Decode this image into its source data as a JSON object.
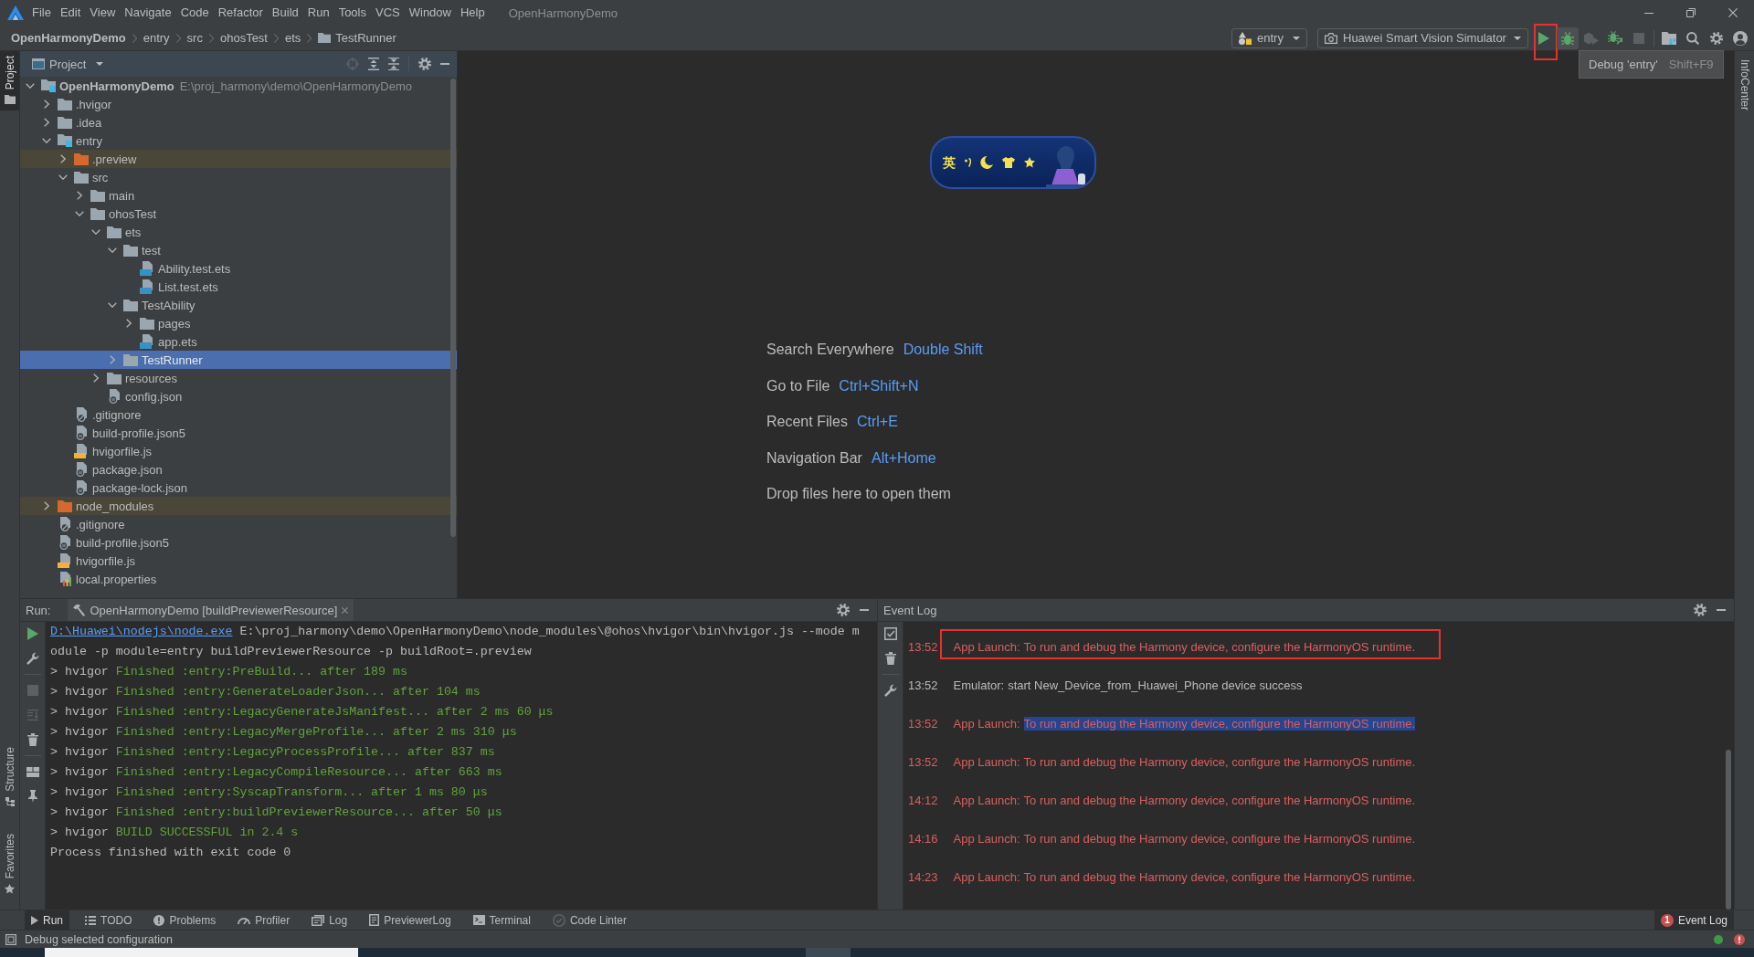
{
  "menu_bar": {
    "items": [
      "File",
      "Edit",
      "View",
      "Navigate",
      "Code",
      "Refactor",
      "Build",
      "Run",
      "Tools",
      "VCS",
      "Window",
      "Help"
    ],
    "project_title": "OpenHarmonyDemo"
  },
  "navigation_bar": {
    "breadcrumb": [
      {
        "label": "OpenHarmonyDemo",
        "kind": "project"
      },
      {
        "label": "entry",
        "kind": "directory"
      },
      {
        "label": "src",
        "kind": "directory"
      },
      {
        "label": "ohosTest",
        "kind": "directory"
      },
      {
        "label": "ets",
        "kind": "directory"
      },
      {
        "label": "TestRunner",
        "kind": "folder"
      }
    ],
    "run_configuration": "entry",
    "device": "Huawei Smart Vision Simulator",
    "run_toolbar": [
      {
        "kind": "run",
        "disabled": false,
        "hovered": false,
        "annotated": true
      },
      {
        "kind": "debug",
        "disabled": false,
        "hovered": true,
        "annotated": false
      },
      {
        "kind": "profile",
        "disabled": true,
        "hovered": false,
        "annotated": false
      },
      {
        "kind": "attach-debugger",
        "disabled": false,
        "hovered": false,
        "annotated": false
      },
      {
        "kind": "stop",
        "disabled": true,
        "hovered": false,
        "annotated": false
      }
    ],
    "app_tools": [
      {
        "kind": "project-structure",
        "disabled": false,
        "hovered": false,
        "annotated": false
      },
      {
        "kind": "search",
        "disabled": false,
        "hovered": false,
        "annotated": false
      },
      {
        "kind": "settings",
        "disabled": false,
        "hovered": false,
        "annotated": false
      },
      {
        "kind": "account",
        "disabled": false,
        "hovered": false,
        "annotated": false
      }
    ],
    "tooltip": {
      "text": "Debug 'entry'",
      "shortcut": "Shift+F9"
    }
  },
  "left_stripe": {
    "top": [
      {
        "label": "Project",
        "kind": "project",
        "selected": true
      }
    ],
    "bottom": [
      {
        "label": "Structure",
        "kind": "structure",
        "selected": false
      },
      {
        "label": "Favorites",
        "kind": "favorites",
        "selected": false
      }
    ]
  },
  "right_stripe": [
    {
      "label": "InfoCenter",
      "selected": false
    }
  ],
  "project_panel": {
    "title": "Project",
    "tree": [
      {
        "name": "OpenHarmonyDemo",
        "kind": "module",
        "path": "E:\\proj_harmony\\demo\\OpenHarmonyDemo",
        "expanded": true,
        "selected": false,
        "children": [
          {
            "name": ".hvigor",
            "kind": "folder",
            "expanded": false,
            "selected": false
          },
          {
            "name": ".idea",
            "kind": "folder",
            "expanded": false,
            "selected": false
          },
          {
            "name": "entry",
            "kind": "module",
            "expanded": true,
            "selected": false,
            "children": [
              {
                "name": ".preview",
                "kind": "excluded-folder",
                "expanded": false,
                "selected": false
              },
              {
                "name": "src",
                "kind": "folder",
                "expanded": true,
                "selected": false,
                "children": [
                  {
                    "name": "main",
                    "kind": "folder",
                    "expanded": false,
                    "selected": false
                  },
                  {
                    "name": "ohosTest",
                    "kind": "folder",
                    "expanded": true,
                    "selected": false,
                    "children": [
                      {
                        "name": "ets",
                        "kind": "folder",
                        "expanded": true,
                        "selected": false,
                        "children": [
                          {
                            "name": "test",
                            "kind": "folder",
                            "expanded": true,
                            "selected": false,
                            "children": [
                              {
                                "name": "Ability.test.ets",
                                "kind": "ets-file",
                                "selected": false
                              },
                              {
                                "name": "List.test.ets",
                                "kind": "ets-file",
                                "selected": false
                              }
                            ]
                          },
                          {
                            "name": "TestAbility",
                            "kind": "folder",
                            "expanded": true,
                            "selected": false,
                            "children": [
                              {
                                "name": "pages",
                                "kind": "folder",
                                "expanded": false,
                                "selected": false
                              },
                              {
                                "name": "app.ets",
                                "kind": "ets-file",
                                "selected": false
                              }
                            ]
                          },
                          {
                            "name": "TestRunner",
                            "kind": "folder",
                            "expanded": false,
                            "selected": true
                          }
                        ]
                      },
                      {
                        "name": "resources",
                        "kind": "folder",
                        "expanded": false,
                        "selected": false
                      },
                      {
                        "name": "config.json",
                        "kind": "json-file",
                        "selected": false
                      }
                    ]
                  }
                ]
              },
              {
                "name": ".gitignore",
                "kind": "ignore-file",
                "selected": false
              },
              {
                "name": "build-profile.json5",
                "kind": "json-file",
                "selected": false
              },
              {
                "name": "hvigorfile.js",
                "kind": "js-file",
                "selected": false
              },
              {
                "name": "package.json",
                "kind": "json-file",
                "selected": false
              },
              {
                "name": "package-lock.json",
                "kind": "json-file",
                "selected": false
              }
            ]
          },
          {
            "name": "node_modules",
            "kind": "excluded-folder",
            "expanded": false,
            "selected": false
          },
          {
            "name": ".gitignore",
            "kind": "ignore-file",
            "selected": false
          },
          {
            "name": "build-profile.json5",
            "kind": "json-file",
            "selected": false
          },
          {
            "name": "hvigorfile.js",
            "kind": "js-file",
            "selected": false
          },
          {
            "name": "local.properties",
            "kind": "properties-file",
            "selected": false
          }
        ]
      }
    ]
  },
  "editor": {
    "input_method": {
      "mode": "英"
    },
    "hints": [
      {
        "label": "Search Everywhere",
        "shortcut": "Double Shift"
      },
      {
        "label": "Go to File",
        "shortcut": "Ctrl+Shift+N"
      },
      {
        "label": "Recent Files",
        "shortcut": "Ctrl+E"
      },
      {
        "label": "Navigation Bar",
        "shortcut": "Alt+Home"
      },
      {
        "label": "Drop files here to open them"
      }
    ]
  },
  "run_panel": {
    "label": "Run:",
    "tab": "OpenHarmonyDemo [buildPreviewerResource]",
    "toolbar": [
      [
        {
          "kind": "rerun",
          "disabled": false
        },
        {
          "kind": "edit-configuration",
          "disabled": false
        }
      ],
      [
        {
          "kind": "stop",
          "disabled": true
        },
        {
          "kind": "scroll-to-end",
          "disabled": true
        },
        {
          "kind": "clear",
          "disabled": false
        }
      ],
      [
        {
          "kind": "layout",
          "disabled": false
        },
        {
          "kind": "pin",
          "disabled": false
        }
      ]
    ],
    "console": [
      {
        "kind": "command",
        "link": "D:\\Huawei\\nodejs\\node.exe",
        "text": "E:\\proj_harmony\\demo\\OpenHarmonyDemo\\node_modules\\@ohos\\hvigor\\bin\\hvigor.js --mode module -p module=entry buildPreviewerResource -p buildRoot=.preview"
      },
      {
        "kind": "task",
        "prompt": "> hvigor",
        "text": "Finished :entry:PreBuild... after 189 ms"
      },
      {
        "kind": "task",
        "prompt": "> hvigor",
        "text": "Finished :entry:GenerateLoaderJson... after 104 ms"
      },
      {
        "kind": "task",
        "prompt": "> hvigor",
        "text": "Finished :entry:LegacyGenerateJsManifest... after 2 ms 60 μs"
      },
      {
        "kind": "task",
        "prompt": "> hvigor",
        "text": "Finished :entry:LegacyMergeProfile... after 2 ms 310 μs"
      },
      {
        "kind": "task",
        "prompt": "> hvigor",
        "text": "Finished :entry:LegacyProcessProfile... after 837 ms"
      },
      {
        "kind": "task",
        "prompt": "> hvigor",
        "text": "Finished :entry:LegacyCompileResource... after 663 ms"
      },
      {
        "kind": "task",
        "prompt": "> hvigor",
        "text": "Finished :entry:SyscapTransform... after 1 ms 80 μs"
      },
      {
        "kind": "task",
        "prompt": "> hvigor",
        "text": "Finished :entry:buildPreviewerResource... after 50 μs"
      },
      {
        "kind": "task",
        "prompt": "> hvigor",
        "text": "BUILD SUCCESSFUL in 2.4 s"
      },
      {
        "kind": "plain",
        "text": "Process finished with exit code 0"
      }
    ]
  },
  "event_log": {
    "title": "Event Log",
    "toolbar": [
      [
        {
          "kind": "mark-read"
        },
        {
          "kind": "clear"
        }
      ],
      [
        {
          "kind": "configure"
        }
      ]
    ],
    "entries": [
      {
        "time": "13:52",
        "source": "App Launch:",
        "message": "To run and debug the Harmony device, configure the HarmonyOS runtime.",
        "kind": "error",
        "text_selected": false,
        "annotated": true
      },
      {
        "time": "13:52",
        "source": "Emulator:",
        "message": "start New_Device_from_Huawei_Phone device success",
        "kind": "info",
        "text_selected": false,
        "annotated": false
      },
      {
        "time": "13:52",
        "source": "App Launch:",
        "message": "To run and debug the Harmony device, configure the HarmonyOS runtime.",
        "kind": "error",
        "text_selected": true,
        "annotated": false
      },
      {
        "time": "13:52",
        "source": "App Launch:",
        "message": "To run and debug the Harmony device, configure the HarmonyOS runtime.",
        "kind": "error",
        "text_selected": false,
        "annotated": false
      },
      {
        "time": "14:12",
        "source": "App Launch:",
        "message": "To run and debug the Harmony device, configure the HarmonyOS runtime.",
        "kind": "error",
        "text_selected": false,
        "annotated": false
      },
      {
        "time": "14:16",
        "source": "App Launch:",
        "message": "To run and debug the Harmony device, configure the HarmonyOS runtime.",
        "kind": "error",
        "text_selected": false,
        "annotated": false
      },
      {
        "time": "14:23",
        "source": "App Launch:",
        "message": "To run and debug the Harmony device, configure the HarmonyOS runtime.",
        "kind": "error",
        "text_selected": false,
        "annotated": false
      }
    ]
  },
  "tool_window_bar": {
    "left_tabs": [
      {
        "label": "Run",
        "kind": "run",
        "selected": true
      },
      {
        "label": "TODO",
        "kind": "todo",
        "selected": false
      },
      {
        "label": "Problems",
        "kind": "problems",
        "selected": false
      },
      {
        "label": "Profiler",
        "kind": "profiler",
        "selected": false
      },
      {
        "label": "Log",
        "kind": "log",
        "selected": false
      },
      {
        "label": "PreviewerLog",
        "kind": "previewer-log",
        "selected": false
      },
      {
        "label": "Terminal",
        "kind": "terminal",
        "selected": false
      },
      {
        "label": "Code Linter",
        "kind": "code-linter",
        "selected": false
      }
    ],
    "right_tabs": [
      {
        "label": "Event Log",
        "selected": true,
        "badge": "1"
      }
    ]
  },
  "status_bar": {
    "message": "Debug selected configuration"
  }
}
